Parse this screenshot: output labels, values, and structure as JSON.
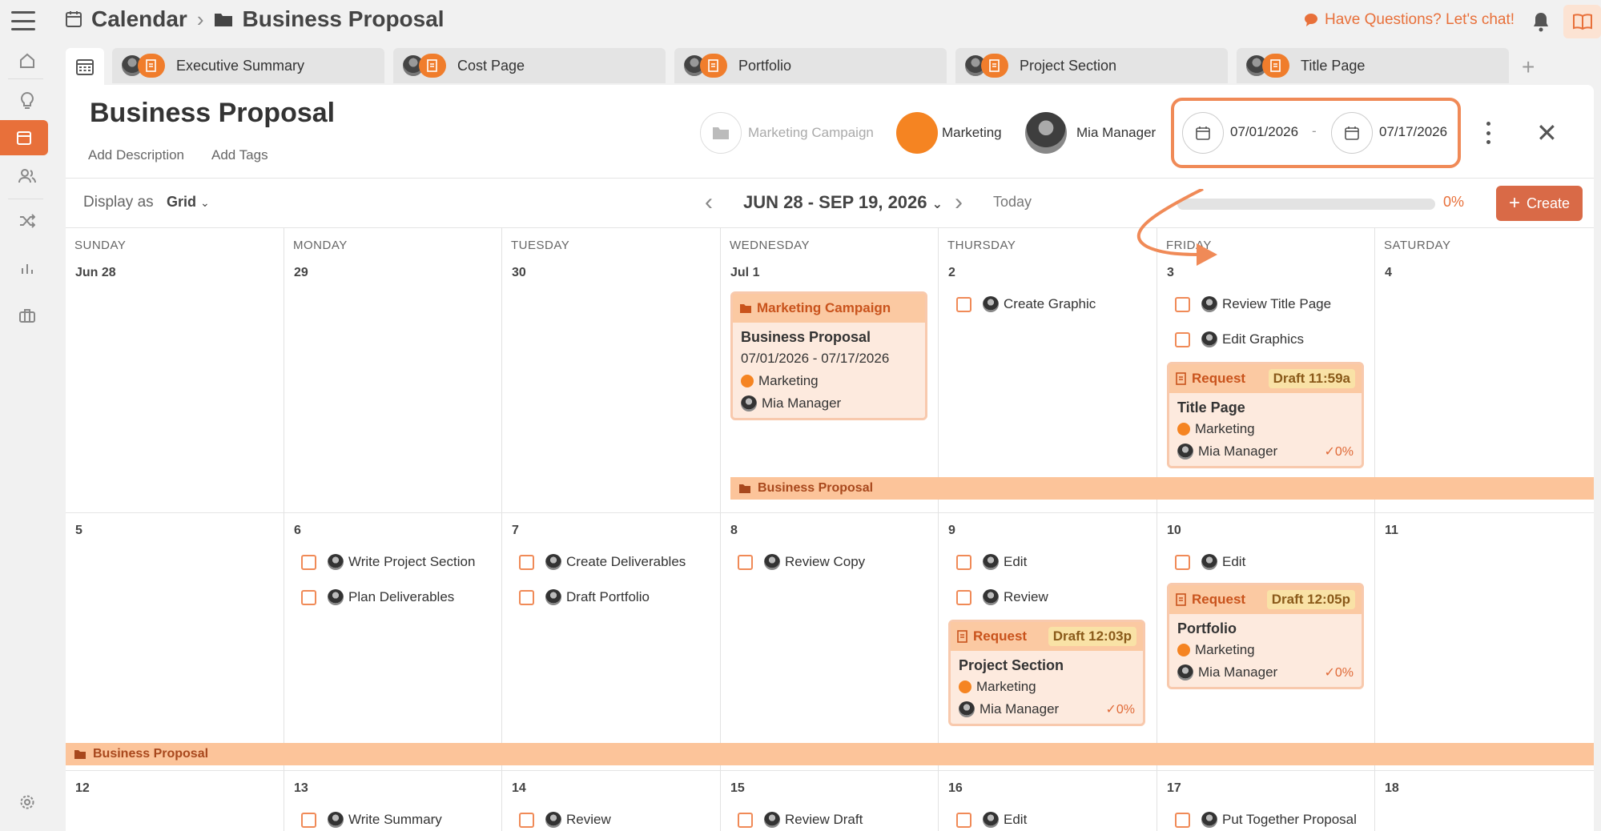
{
  "breadcrumb": {
    "root": "Calendar",
    "current": "Business Proposal"
  },
  "header": {
    "chat": "Have Questions? Let's chat!"
  },
  "tabs": [
    {
      "label": "Executive Summary"
    },
    {
      "label": "Cost Page"
    },
    {
      "label": "Portfolio"
    },
    {
      "label": "Project Section"
    },
    {
      "label": "Title Page"
    }
  ],
  "project": {
    "title": "Business Proposal",
    "add_description": "Add Description",
    "add_tags": "Add Tags",
    "campaign": "Marketing Campaign",
    "team": "Marketing",
    "owner": "Mia Manager",
    "start_date": "07/01/2026",
    "end_date": "07/17/2026",
    "date_sep": "-",
    "close": "✕"
  },
  "toolbar": {
    "display_as": "Display as",
    "view": "Grid",
    "range": "JUN 28 - SEP 19, 2026",
    "today": "Today",
    "progress_percent": 0,
    "progress_label": "0%",
    "create": "Create"
  },
  "days": [
    "SUNDAY",
    "MONDAY",
    "TUESDAY",
    "WEDNESDAY",
    "THURSDAY",
    "FRIDAY",
    "SATURDAY"
  ],
  "weeks": [
    {
      "dates": [
        "Jun 28",
        "29",
        "30",
        "Jul 1",
        "2",
        "3",
        "4"
      ]
    },
    {
      "dates": [
        "5",
        "6",
        "7",
        "8",
        "9",
        "10",
        "11"
      ]
    },
    {
      "dates": [
        "12",
        "13",
        "14",
        "15",
        "16",
        "17",
        "18"
      ]
    }
  ],
  "tasks": {
    "w1_thu": "Create Graphic",
    "w1_fri_1": "Review Title Page",
    "w1_fri_2": "Edit Graphics",
    "w2_mon_1": "Write Project Section",
    "w2_mon_2": "Plan Deliverables",
    "w2_tue_1": "Create Deliverables",
    "w2_tue_2": "Draft Portfolio",
    "w2_wed_1": "Review Copy",
    "w2_thu_1": "Edit",
    "w2_thu_2": "Review",
    "w2_fri_1": "Edit",
    "w3_mon_1": "Write Summary",
    "w3_tue_1": "Review",
    "w3_wed_1": "Review Draft",
    "w3_thu_1": "Edit",
    "w3_fri_1": "Put Together Proposal"
  },
  "campaign_card": {
    "header": "Marketing Campaign",
    "title": "Business Proposal",
    "dates": "07/01/2026 - 07/17/2026",
    "team": "Marketing",
    "owner": "Mia Manager"
  },
  "request_cards": {
    "title_page": {
      "type": "Request",
      "status": "Draft 11:59a",
      "title": "Title Page",
      "team": "Marketing",
      "owner": "Mia Manager",
      "pct": "0%"
    },
    "portfolio": {
      "type": "Request",
      "status": "Draft 12:05p",
      "title": "Portfolio",
      "team": "Marketing",
      "owner": "Mia Manager",
      "pct": "0%"
    },
    "project_section": {
      "type": "Request",
      "status": "Draft 12:03p",
      "title": "Project Section",
      "team": "Marketing",
      "owner": "Mia Manager",
      "pct": "0%"
    }
  },
  "span_bars": {
    "w1": "Business Proposal",
    "w2": "Business Proposal"
  },
  "colors": {
    "accent": "#e8703a",
    "team_dot": "#f58422",
    "card_bg": "#fdeade",
    "bar": "#fcc49a"
  }
}
